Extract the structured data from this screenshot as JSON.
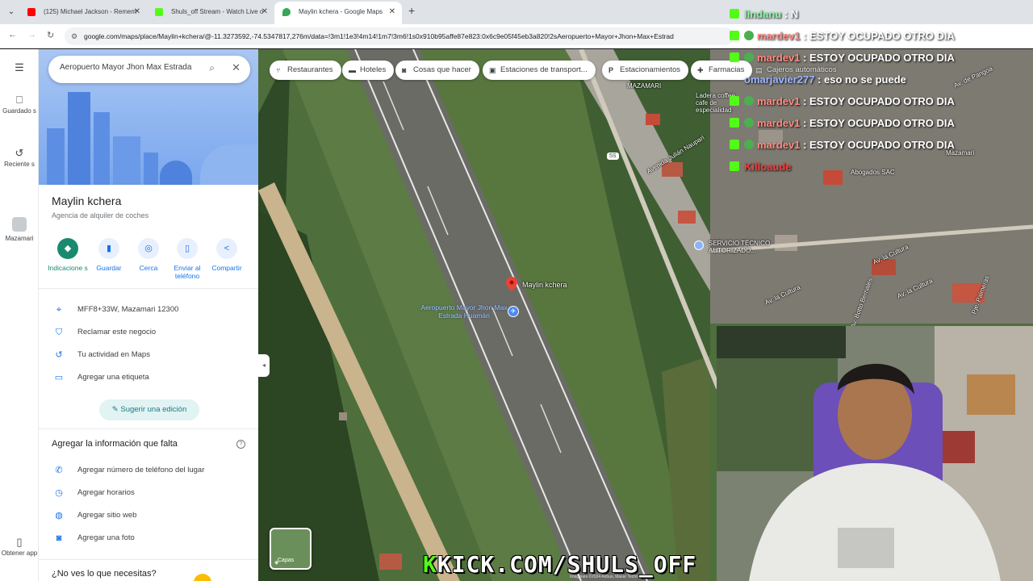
{
  "browser": {
    "tabs": [
      {
        "title": "(125) Michael Jackson - Remem",
        "favicon_color": "#ff0000"
      },
      {
        "title": "Shuls_off Stream - Watch Live o",
        "favicon_color": "#53fc18"
      },
      {
        "title": "Maylin kchera - Google Maps",
        "favicon_color": "#34a853"
      }
    ],
    "url": "google.com/maps/place/Maylin+kchera/@-11.3273592,-74.5347817,276m/data=!3m1!1e3!4m14!1m7!3m6!1s0x910b95affe87e823:0x6c9e05f45eb3a820!2sAeropuerto+Mayor+Jhon+Max+Estrad"
  },
  "rail": {
    "items": [
      {
        "icon": "bookmark-icon",
        "label": "Guardado s"
      },
      {
        "icon": "history-icon",
        "label": "Reciente s"
      },
      {
        "icon": "place-thumb-icon",
        "label": "Mazamari"
      },
      {
        "icon": "phone-icon",
        "label": "Obtener app"
      }
    ]
  },
  "panel": {
    "search_value": "Aeropuerto Mayor Jhon Max Estrada",
    "place_name": "Maylin kchera",
    "place_type": "Agencia de alquiler de coches",
    "actions": [
      {
        "label": "Indicacione s",
        "icon": "◆"
      },
      {
        "label": "Guardar",
        "icon": "▮"
      },
      {
        "label": "Cerca",
        "icon": "◎"
      },
      {
        "label": "Enviar al teléfono",
        "icon": "▯"
      },
      {
        "label": "Compartir",
        "icon": "<"
      }
    ],
    "info": [
      {
        "icon": "location-pin-icon",
        "glyph": "⌖",
        "text": "MFF8+33W, Mazamari 12300"
      },
      {
        "icon": "verified-shield-icon",
        "glyph": "⛉",
        "text": "Reclamar este negocio"
      },
      {
        "icon": "history-icon",
        "glyph": "↺",
        "text": "Tu actividad en Maps"
      },
      {
        "icon": "label-icon",
        "glyph": "▭",
        "text": "Agregar una etiqueta"
      }
    ],
    "suggest_label": "Sugerir una edición",
    "missing_title": "Agregar la información que falta",
    "missing": [
      {
        "icon": "phone-icon",
        "glyph": "✆",
        "text": "Agregar número de teléfono del lugar"
      },
      {
        "icon": "clock-icon",
        "glyph": "◷",
        "text": "Agregar horarios"
      },
      {
        "icon": "globe-icon",
        "glyph": "◍",
        "text": "Agregar sitio web"
      },
      {
        "icon": "camera-icon",
        "glyph": "◙",
        "text": "Agregar una foto"
      }
    ],
    "no_looking": "¿No ves lo que necesitas?"
  },
  "map": {
    "chips": [
      {
        "label": "Restaurantes",
        "icon": "fork-knife-icon"
      },
      {
        "label": "Hoteles",
        "icon": "bed-icon"
      },
      {
        "label": "Cosas que hacer",
        "icon": "camera-icon"
      },
      {
        "label": "Estaciones de transport...",
        "icon": "bus-icon"
      },
      {
        "label": "Estacionamientos",
        "icon": "parking-icon"
      },
      {
        "label": "Farmacias",
        "icon": "pharmacy-icon"
      },
      {
        "label": "Cajeros automáticos",
        "icon": "atm-icon"
      }
    ],
    "pin_label": "Maylin kchera",
    "airport_label": "Aeropuerto Mayor Jhon Max Estrada Huamán",
    "labels": [
      {
        "text": "MAZAMARI"
      },
      {
        "text": "Ladera coffee cafe de especialidad"
      },
      {
        "text": "Avenida Julián Naupari"
      },
      {
        "text": "SERVICIO TÉCNICO AUTORIZADO..."
      },
      {
        "text": "Av. la Cultura"
      },
      {
        "text": "Av. la Cultura"
      },
      {
        "text": "Av. Botto Bernales"
      },
      {
        "text": "Pje. Palmeras"
      },
      {
        "text": "Av. la Cultura"
      },
      {
        "text": "Av. de Pangoa"
      },
      {
        "text": "Abogados SAC"
      },
      {
        "text": "Mazamari"
      },
      {
        "text": "5S"
      }
    ],
    "layers_label": "Capas",
    "attribution": "Imágenes ©2024 Airbus, Maxar Technologies"
  },
  "overlay": {
    "watermark_k": "K",
    "watermark_rest": "KICK.COM/SHULS_OFF",
    "chat": [
      {
        "user": "lindanu",
        "msg": ": N"
      },
      {
        "user": "mardev1",
        "msg": ": ESTOY OCUPADO OTRO DIA"
      },
      {
        "user": "mardev1",
        "msg": ": ESTOY OCUPADO OTRO DIA"
      },
      {
        "user": "omarjavier277",
        "msg": ": eso no se puede"
      },
      {
        "user": "mardev1",
        "msg": ": ESTOY OCUPADO OTRO DIA"
      },
      {
        "user": "mardev1",
        "msg": ": ESTOY OCUPADO OTRO DIA"
      },
      {
        "user": "mardev1",
        "msg": ": ESTOY OCUPADO OTRO DIA"
      },
      {
        "user": "Killoaude",
        "msg": ""
      }
    ]
  }
}
